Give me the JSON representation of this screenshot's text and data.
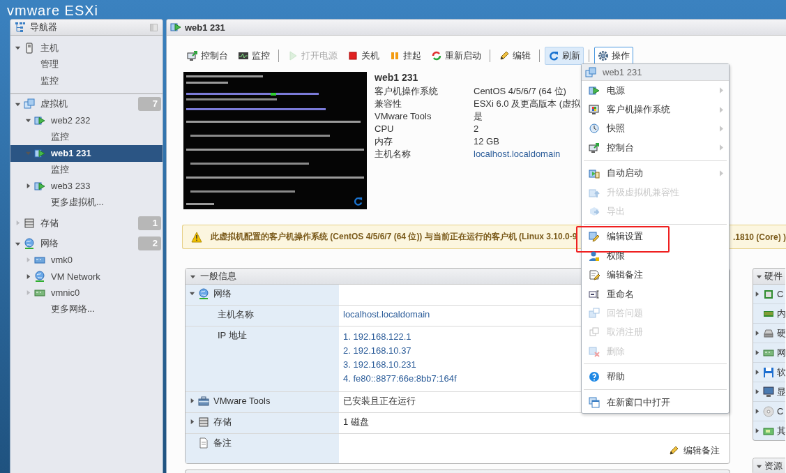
{
  "header": {
    "logo": "vmware ESXi"
  },
  "navigator": {
    "title": "导航器",
    "groups": [
      {
        "label": "主机",
        "expanded": true,
        "expandable": true,
        "selected": false,
        "children": [
          {
            "label": "管理",
            "selected": false
          },
          {
            "label": "监控",
            "selected": false
          }
        ]
      },
      {
        "label": "虚拟机",
        "badge": "7",
        "expanded": true,
        "expandable": true,
        "selected": false,
        "children": [
          {
            "label": "web2 232",
            "expanded": true,
            "expandable": true,
            "selected": false,
            "children": [
              {
                "label": "监控",
                "selected": false
              }
            ]
          },
          {
            "label": "web1 231",
            "expanded": true,
            "expandable": true,
            "selected": true,
            "children": [
              {
                "label": "监控",
                "selected": false
              }
            ]
          },
          {
            "label": "web3 233",
            "expanded": false,
            "expandable": true,
            "selected": false
          },
          {
            "label": "更多虚拟机...",
            "selected": false
          }
        ]
      },
      {
        "label": "存储",
        "badge": "1",
        "expanded": false,
        "expandable": false,
        "selected": false
      },
      {
        "label": "网络",
        "badge": "2",
        "expanded": true,
        "expandable": true,
        "selected": false,
        "children": [
          {
            "label": "vmk0",
            "expanded": false,
            "expandable": false,
            "selected": false
          },
          {
            "label": "VM Network",
            "expanded": false,
            "expandable": true,
            "selected": false
          },
          {
            "label": "vmnic0",
            "expanded": false,
            "expandable": false,
            "selected": false
          },
          {
            "label": "更多网络...",
            "selected": false
          }
        ]
      }
    ]
  },
  "vm_page": {
    "title": "web1 231",
    "toolbar": [
      {
        "kind": "button",
        "label": "控制台",
        "disabled": false,
        "hovered": false,
        "pressed": false
      },
      {
        "kind": "button",
        "label": "监控",
        "disabled": false,
        "hovered": false,
        "pressed": false
      },
      {
        "kind": "separator"
      },
      {
        "kind": "button",
        "label": "打开电源",
        "disabled": true,
        "hovered": false,
        "pressed": false
      },
      {
        "kind": "button",
        "label": "关机",
        "disabled": false,
        "hovered": false,
        "pressed": false
      },
      {
        "kind": "button",
        "label": "挂起",
        "disabled": false,
        "hovered": false,
        "pressed": false
      },
      {
        "kind": "button",
        "label": "重新启动",
        "disabled": false,
        "hovered": false,
        "pressed": false
      },
      {
        "kind": "separator"
      },
      {
        "kind": "button",
        "label": "编辑",
        "disabled": false,
        "hovered": false,
        "pressed": false
      },
      {
        "kind": "separator"
      },
      {
        "kind": "button",
        "label": "刷新",
        "disabled": false,
        "hovered": true,
        "pressed": false
      },
      {
        "kind": "separator"
      },
      {
        "kind": "button",
        "label": "操作",
        "disabled": false,
        "hovered": false,
        "pressed": true
      }
    ],
    "summary": {
      "name": "web1 231",
      "fields": [
        {
          "label": "客户机操作系统",
          "value": "CentOS 4/5/6/7 (64 位)",
          "link": false
        },
        {
          "label": "兼容性",
          "value": "ESXi 6.0 及更高版本 (虚拟",
          "link": false
        },
        {
          "label": "VMware Tools",
          "value": "是",
          "link": false
        },
        {
          "label": "CPU",
          "value": "2",
          "link": false
        },
        {
          "label": "内存",
          "value": "12 GB",
          "link": false
        },
        {
          "label": "主机名称",
          "value": "localhost.localdomain",
          "link": true
        }
      ]
    },
    "warning": {
      "text": "此虚拟机配置的客户机操作系统 (CentOS 4/5/6/7 (64 位)) 与当前正在运行的客户机 (Linux 3.10.0-9",
      "text_end": ".1810 (Core) )"
    },
    "general": {
      "title": "一般信息",
      "expanded": true,
      "rows": [
        {
          "label": "网络",
          "expanded": true,
          "children": [
            {
              "label": "主机名称",
              "value": "localhost.localdomain",
              "link": true
            },
            {
              "label": "IP 地址",
              "values": [
                "1. 192.168.122.1",
                "2. 192.168.10.37",
                "3. 192.168.10.231",
                "4. fe80::8877:66e:8bb7:164f"
              ],
              "link": true
            }
          ]
        },
        {
          "label": "VMware Tools",
          "expanded": false,
          "value": "已安装且正在运行",
          "link": false
        },
        {
          "label": "存储",
          "expanded": false,
          "value": "1 磁盘",
          "link": false
        },
        {
          "label": "备注",
          "action": "编辑备注"
        }
      ]
    },
    "hardware": {
      "title": "硬件",
      "expanded": true,
      "items": [
        {
          "label": "C",
          "expandable": true
        },
        {
          "label": "内",
          "expandable": false
        },
        {
          "label": "硬",
          "expandable": true
        },
        {
          "label": "网",
          "expandable": true
        },
        {
          "label": "软",
          "expandable": true
        },
        {
          "label": "显",
          "expandable": true
        },
        {
          "label": "C",
          "expandable": true
        },
        {
          "label": "其",
          "expandable": true
        }
      ]
    },
    "resources": {
      "title": "资源",
      "expanded": true
    },
    "menu": {
      "title": "web1 231",
      "items": [
        {
          "kind": "item",
          "label": "电源",
          "disabled": false,
          "submenu": true,
          "highlighted": false
        },
        {
          "kind": "item",
          "label": "客户机操作系统",
          "disabled": false,
          "submenu": true,
          "highlighted": false
        },
        {
          "kind": "item",
          "label": "快照",
          "disabled": false,
          "submenu": true,
          "highlighted": false
        },
        {
          "kind": "item",
          "label": "控制台",
          "disabled": false,
          "submenu": true,
          "highlighted": false
        },
        {
          "kind": "separator"
        },
        {
          "kind": "item",
          "label": "自动启动",
          "disabled": false,
          "submenu": true,
          "highlighted": false
        },
        {
          "kind": "item",
          "label": "升级虚拟机兼容性",
          "disabled": true,
          "submenu": false,
          "highlighted": false
        },
        {
          "kind": "item",
          "label": "导出",
          "disabled": true,
          "submenu": false,
          "highlighted": false
        },
        {
          "kind": "separator"
        },
        {
          "kind": "item",
          "label": "编辑设置",
          "disabled": false,
          "submenu": false,
          "highlighted": true
        },
        {
          "kind": "item",
          "label": "权限",
          "disabled": false,
          "submenu": false,
          "highlighted": false
        },
        {
          "kind": "item",
          "label": "编辑备注",
          "disabled": false,
          "submenu": false,
          "highlighted": false
        },
        {
          "kind": "item",
          "label": "重命名",
          "disabled": false,
          "submenu": false,
          "highlighted": false
        },
        {
          "kind": "item",
          "label": "回答问题",
          "disabled": true,
          "submenu": false,
          "highlighted": false
        },
        {
          "kind": "item",
          "label": "取消注册",
          "disabled": true,
          "submenu": false,
          "highlighted": false
        },
        {
          "kind": "item",
          "label": "删除",
          "disabled": true,
          "submenu": false,
          "highlighted": false
        },
        {
          "kind": "separator"
        },
        {
          "kind": "item",
          "label": "帮助",
          "disabled": false,
          "submenu": false,
          "highlighted": false
        },
        {
          "kind": "separator"
        },
        {
          "kind": "item",
          "label": "在新窗口中打开",
          "disabled": false,
          "submenu": false,
          "highlighted": false
        }
      ]
    }
  }
}
